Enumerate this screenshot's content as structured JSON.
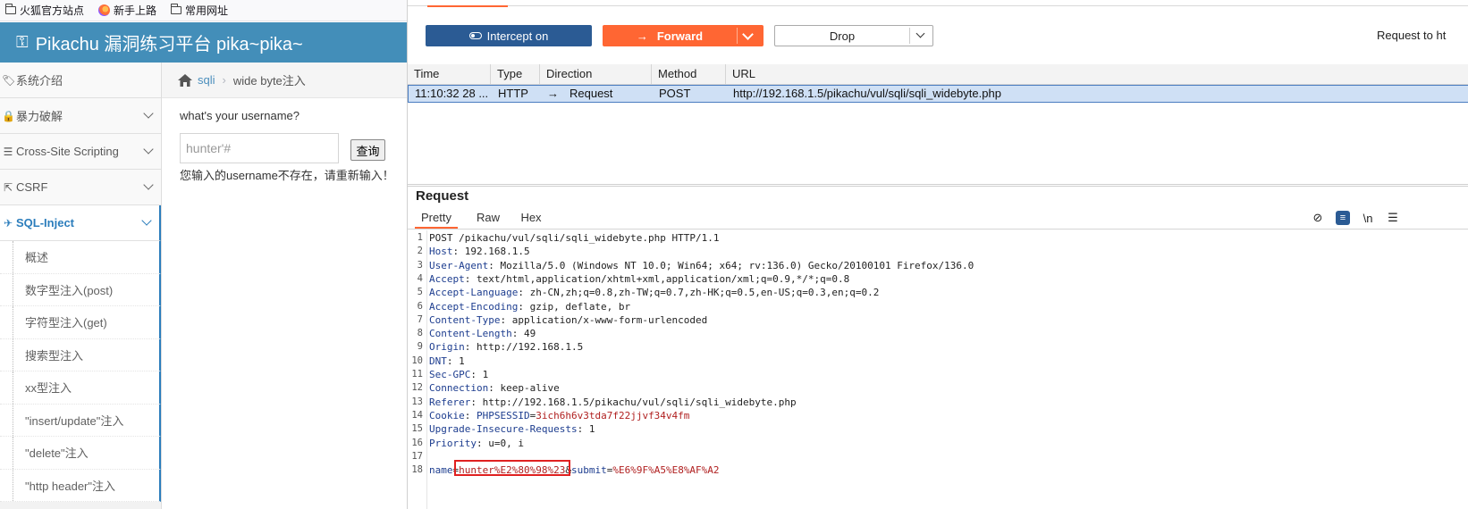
{
  "bookmarks": [
    {
      "icon": "folder-icon",
      "label": "火狐官方站点"
    },
    {
      "icon": "firefox-icon",
      "label": "新手上路"
    },
    {
      "icon": "folder-icon",
      "label": "常用网址"
    }
  ],
  "app": {
    "title": "Pikachu 漏洞练习平台 pika~pika~"
  },
  "sidebar": {
    "items": [
      {
        "label": "系统介绍",
        "icon": "tag-icon"
      },
      {
        "label": "暴力破解",
        "icon": "lock-icon"
      },
      {
        "label": "Cross-Site Scripting",
        "icon": "sliders-icon"
      },
      {
        "label": "CSRF",
        "icon": "external-link-icon"
      },
      {
        "label": "SQL-Inject",
        "icon": "fighter-jet-icon"
      }
    ],
    "sub_items": [
      "概述",
      "数字型注入(post)",
      "字符型注入(get)",
      "搜索型注入",
      "xx型注入",
      "\"insert/update\"注入",
      "\"delete\"注入",
      "\"http header\"注入"
    ]
  },
  "breadcrumb": {
    "link": "sqli",
    "current": "wide byte注入"
  },
  "form": {
    "question": "what's your username?",
    "input_value": "hunter'#",
    "submit_label": "查询",
    "message": "您输入的username不存在，请重新输入！"
  },
  "burp": {
    "intercept_label": "Intercept on",
    "forward_label": "Forward",
    "drop_label": "Drop",
    "request_to": "Request to ht",
    "history_columns": [
      "Time",
      "Type",
      "Direction",
      "Method",
      "URL"
    ],
    "history_row": {
      "time": "11:10:32 28 ...",
      "type": "HTTP",
      "direction": "Request",
      "method": "POST",
      "url": "http://192.168.1.5/pikachu/vul/sqli/sqli_widebyte.php"
    },
    "request_title": "Request",
    "tabs": [
      "Pretty",
      "Raw",
      "Hex"
    ],
    "request_lines": [
      {
        "k": "",
        "v": "POST /pikachu/vul/sqli/sqli_widebyte.php HTTP/1.1"
      },
      {
        "k": "Host",
        "v": ": 192.168.1.5"
      },
      {
        "k": "User-Agent",
        "v": ": Mozilla/5.0 (Windows NT 10.0; Win64; x64; rv:136.0) Gecko/20100101 Firefox/136.0"
      },
      {
        "k": "Accept",
        "v": ": text/html,application/xhtml+xml,application/xml;q=0.9,*/*;q=0.8"
      },
      {
        "k": "Accept-Language",
        "v": ": zh-CN,zh;q=0.8,zh-TW;q=0.7,zh-HK;q=0.5,en-US;q=0.3,en;q=0.2"
      },
      {
        "k": "Accept-Encoding",
        "v": ": gzip, deflate, br"
      },
      {
        "k": "Content-Type",
        "v": ": application/x-www-form-urlencoded"
      },
      {
        "k": "Content-Length",
        "v": ": 49"
      },
      {
        "k": "Origin",
        "v": ": http://192.168.1.5"
      },
      {
        "k": "DNT",
        "v": ": 1"
      },
      {
        "k": "Sec-GPC",
        "v": ": 1"
      },
      {
        "k": "Connection",
        "v": ": keep-alive"
      },
      {
        "k": "Referer",
        "v": ": http://192.168.1.5/pikachu/vul/sqli/sqli_widebyte.php"
      },
      {
        "k": "Cookie",
        "v": ": "
      },
      {
        "k": "Upgrade-Insecure-Requests",
        "v": ": 1"
      },
      {
        "k": "Priority",
        "v": ": u=0, i"
      },
      {
        "k": "",
        "v": ""
      },
      {
        "k": "",
        "v": ""
      }
    ],
    "cookie": {
      "name": "PHPSESSID",
      "value": "3ich6h6v3tda7f22jjvf34v4fm"
    },
    "body": {
      "k1": "name",
      "v1": "hunter%E2%80%98%23",
      "k2": "submit",
      "v2": "%E6%9F%A5%E8%AF%A2"
    }
  },
  "colors": {
    "header_blue": "#438eb9",
    "burp_orange": "#ff6633",
    "burp_blue": "#2b5b94",
    "highlight_red": "#e02020"
  }
}
